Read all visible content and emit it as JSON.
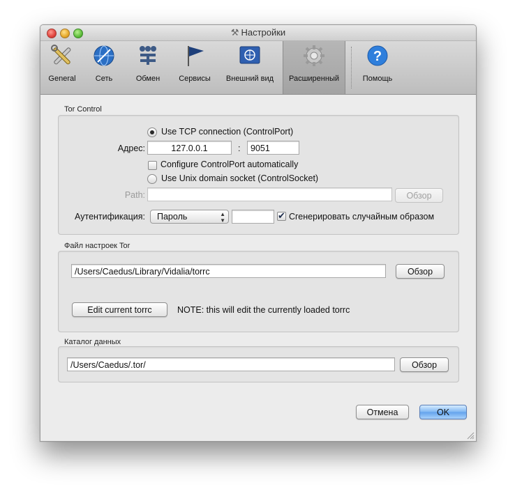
{
  "window": {
    "title": "Настройки"
  },
  "toolbar": {
    "items": [
      {
        "label": "General",
        "icon": "tools-icon"
      },
      {
        "label": "Сеть",
        "icon": "network-globe-icon"
      },
      {
        "label": "Обмен",
        "icon": "sharing-icon"
      },
      {
        "label": "Сервисы",
        "icon": "services-flag-icon"
      },
      {
        "label": "Внешний вид",
        "icon": "appearance-flag-icon"
      },
      {
        "label": "Расширенный",
        "icon": "gear-icon",
        "selected": true
      },
      {
        "label": "Помощь",
        "icon": "help-icon"
      }
    ]
  },
  "tor_control": {
    "title": "Tor Control",
    "tcp_radio_label": "Use TCP connection (ControlPort)",
    "tcp_selected": true,
    "address_label": "Адрес:",
    "address_value": "127.0.0.1",
    "port_separator": ":",
    "port_value": "9051",
    "auto_configure_label": "Configure ControlPort automatically",
    "auto_configure_checked": false,
    "unix_socket_label": "Use Unix domain socket (ControlSocket)",
    "path_label": "Path:",
    "path_value": "",
    "path_browse_label": "Обзор",
    "auth_label": "Аутентификация:",
    "auth_method": "Пароль",
    "password_value": "",
    "random_password_label": "Сгенерировать случайным образом",
    "random_password_checked": true
  },
  "torrc": {
    "title": "Файл настроек Tor",
    "path_value": "/Users/Caedus/Library/Vidalia/torrc",
    "browse_label": "Обзор",
    "edit_button_label": "Edit current torrc",
    "note": "NOTE: this will edit the currently loaded torrc"
  },
  "data_dir": {
    "title": "Каталог данных",
    "path_value": "/Users/Caedus/.tor/",
    "browse_label": "Обзор"
  },
  "footer": {
    "cancel_label": "Отмена",
    "ok_label": "OK"
  },
  "colors": {
    "window_bg": "#ececec",
    "default_button": "#6aa8ee"
  }
}
